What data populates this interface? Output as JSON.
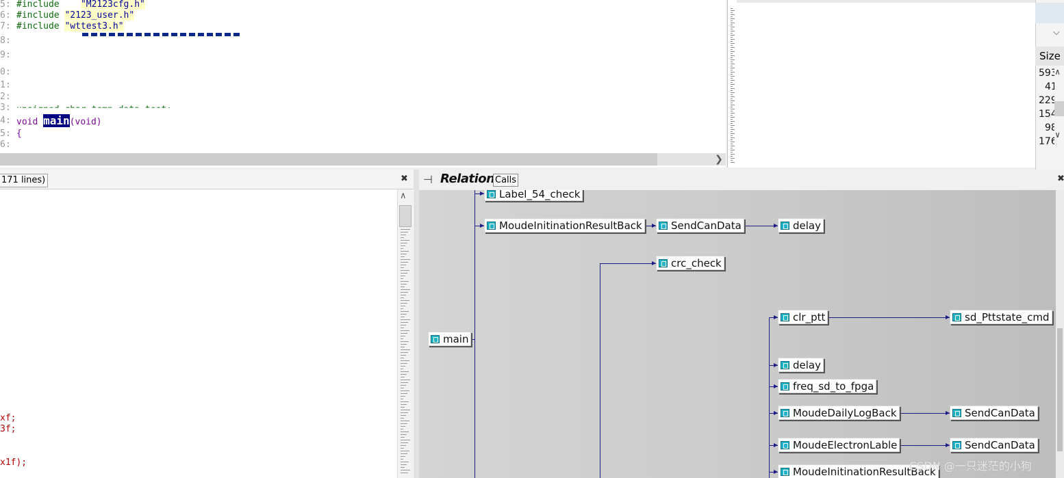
{
  "editor": {
    "lines": [
      {
        "num": "5:",
        "kw": "#include",
        "gap": "    ",
        "str": "\"M2123cfg.h\""
      },
      {
        "num": "6:",
        "kw": "#include",
        "gap": " ",
        "str": "\"2123_user.h\""
      },
      {
        "num": "7:",
        "kw": "#include",
        "gap": " ",
        "str": "\"wttest3.h\""
      },
      {
        "num": "8:"
      },
      {
        "num": "9:"
      },
      {
        "num": "0:"
      },
      {
        "num": "1:"
      },
      {
        "num": "2:"
      },
      {
        "num": "3:",
        "partial": "unsigned char temp_data_test;"
      },
      {
        "num": "4:",
        "void": "void",
        "func": "main",
        "args": "(void)"
      },
      {
        "num": "5:",
        "brace": "{"
      },
      {
        "num": "6:"
      }
    ]
  },
  "right_panel": {
    "size_header": "Size",
    "sizes": [
      "593",
      "41",
      "229",
      "154",
      "98",
      "176"
    ]
  },
  "left_pane": {
    "title": "171 lines)",
    "code": [
      "xf;",
      "3f;",
      "x1f);"
    ]
  },
  "relation": {
    "title": "Relation",
    "tab": "Calls",
    "nodes": {
      "main": "main",
      "label54": "Label_54_check",
      "moude_init1": "MoudeInitinationResultBack",
      "sendcan1": "SendCanData",
      "delay1": "delay",
      "crc": "crc_check",
      "clr_ptt": "clr_ptt",
      "sd_ptt": "sd_Pttstate_cmd",
      "delay2": "delay",
      "freq": "freq_sd_to_fpga",
      "daily": "MoudeDailyLogBack",
      "sendcan2": "SendCanData",
      "elec": "MoudeElectronLable",
      "sendcan3": "SendCanData",
      "moude_init2": "MoudeInitinationResultBack"
    }
  },
  "watermark": "CSDN @一只迷茫的小狗"
}
